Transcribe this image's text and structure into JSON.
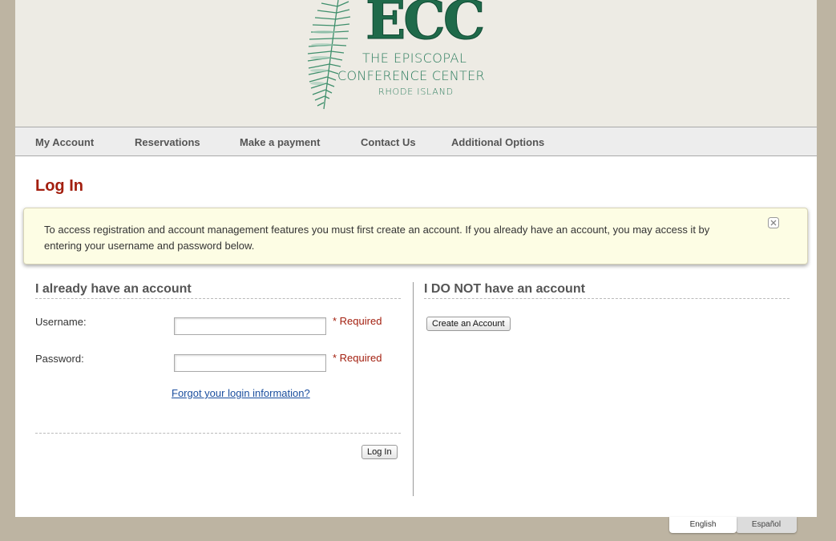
{
  "header": {
    "logo_mark": "ECC",
    "logo_line1": "THE EPISCOPAL",
    "logo_line2": "CONFERENCE CENTER",
    "logo_line3": "RHODE ISLAND",
    "logo_icon": "fern-icon",
    "brand_color": "#1f6a4a"
  },
  "nav": {
    "items": [
      {
        "label": "My Account"
      },
      {
        "label": "Reservations"
      },
      {
        "label": "Make a payment"
      },
      {
        "label": "Contact Us"
      },
      {
        "label": "Additional Options"
      }
    ]
  },
  "main": {
    "title": "Log In",
    "title_color": "#a31f0f",
    "notice": {
      "text": "To access registration and account management features you must first create an account. If you already have an account, you may access it by entering your username and password below.",
      "close_icon": "close-icon"
    },
    "login": {
      "heading": "I already have an account",
      "username_label": "Username:",
      "username_value": "",
      "password_label": "Password:",
      "password_value": "",
      "required_text": "* Required",
      "forgot_link": "Forgot your login information?",
      "submit_label": "Log In"
    },
    "register": {
      "heading": "I DO NOT have an account",
      "create_label": "Create an Account"
    }
  },
  "languages": [
    {
      "label": "English",
      "active": true
    },
    {
      "label": "Español",
      "active": false
    }
  ]
}
